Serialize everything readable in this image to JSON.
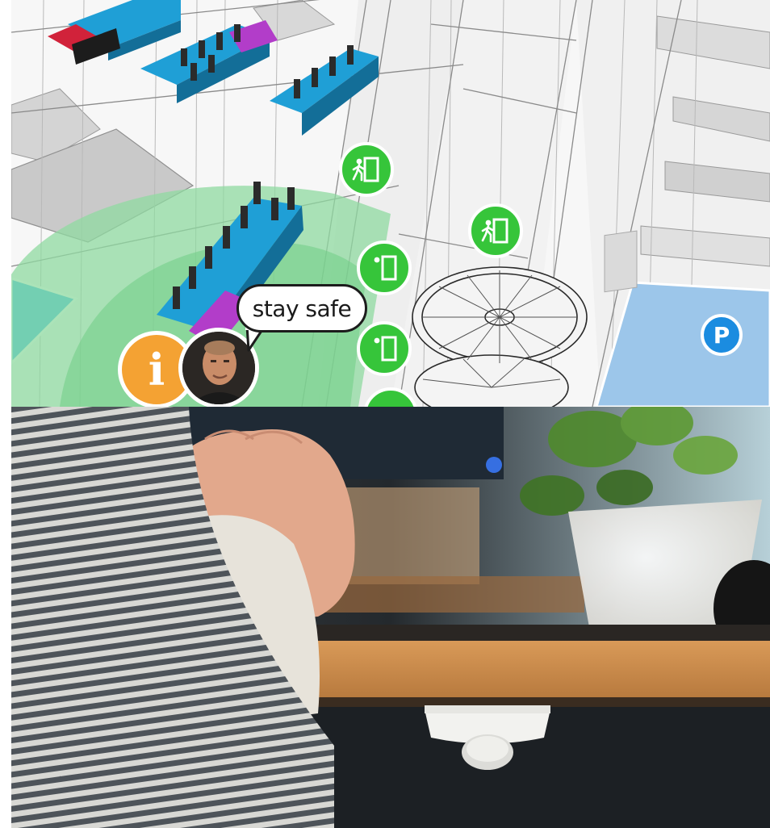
{
  "map": {
    "speech_text": "stay safe",
    "info_icon_glyph": "i",
    "parking_glyph": "P",
    "exit_icon": "emergency-exit-icon",
    "colors": {
      "desk_blue": "#1f9fd6",
      "desk_magenta": "#b23dc9",
      "desk_red": "#d1223a",
      "safe_zone_green": "#8fd9a0",
      "exit_green": "#36c53a",
      "info_orange": "#f4a233",
      "parking_blue": "#1b8ce0",
      "parking_area": "#9cc6ea",
      "room_blue": "#22aee8"
    }
  },
  "photo": {
    "colors": {
      "desk_wood": "#c98a4a",
      "sleeve_stripe_dark": "#4e545a",
      "sleeve_stripe_light": "#d8d8d4",
      "sensor_white": "#f2f2ef",
      "plant_green": "#4f8a2c",
      "pot_white": "#f4f2ec"
    }
  }
}
